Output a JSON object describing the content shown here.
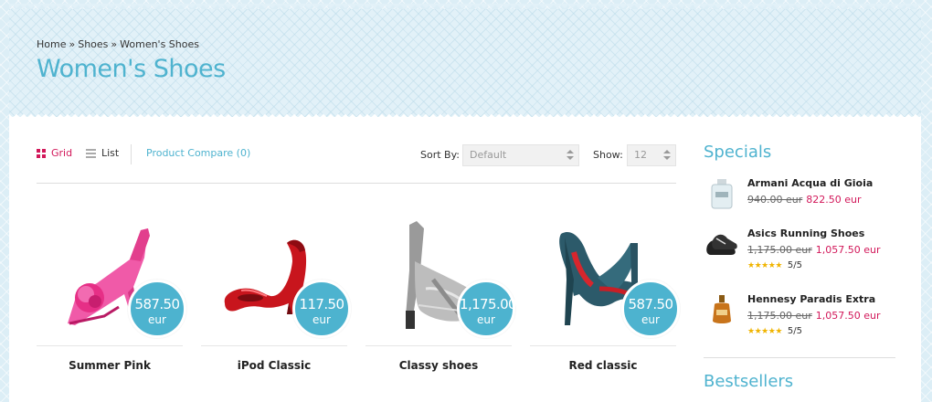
{
  "breadcrumb": {
    "items": [
      "Home",
      "Shoes",
      "Women's Shoes"
    ],
    "separator": "»"
  },
  "page_title": "Women's Shoes",
  "toolbar": {
    "grid_label": "Grid",
    "list_label": "List",
    "compare_label": "Product Compare (0)",
    "sort_label": "Sort By:",
    "sort_value": "Default",
    "show_label": "Show:",
    "show_value": "12"
  },
  "products": [
    {
      "name": "Summer Pink",
      "price": "587.50",
      "currency": "eur",
      "icon": "pink-sandal-image"
    },
    {
      "name": "iPod Classic",
      "price": "117.50",
      "currency": "eur",
      "icon": "red-pump-image"
    },
    {
      "name": "Classy shoes",
      "price": "1,175.00",
      "currency": "eur",
      "icon": "silver-heel-image"
    },
    {
      "name": "Red classic",
      "price": "587.50",
      "currency": "eur",
      "icon": "teal-pump-image"
    }
  ],
  "sidebar": {
    "specials_title": "Specials",
    "specials": [
      {
        "name": "Armani Acqua di Gioia",
        "old_price": "940.00 eur",
        "new_price": "822.50 eur",
        "rating": "",
        "icon": "perfume-bottle-image"
      },
      {
        "name": "Asics Running Shoes",
        "old_price": "1,175.00 eur",
        "new_price": "1,057.50 eur",
        "rating": "5/5",
        "rating_value": 5,
        "icon": "running-shoes-image"
      },
      {
        "name": "Hennesy Paradis Extra",
        "old_price": "1,175.00 eur",
        "new_price": "1,057.50 eur",
        "rating": "5/5",
        "rating_value": 5,
        "icon": "cognac-bottle-image"
      }
    ],
    "bestsellers_title": "Bestsellers"
  },
  "colors": {
    "accent_blue": "#4fb3cf",
    "accent_pink": "#d2185a",
    "badge_blue": "#4db3cf"
  }
}
